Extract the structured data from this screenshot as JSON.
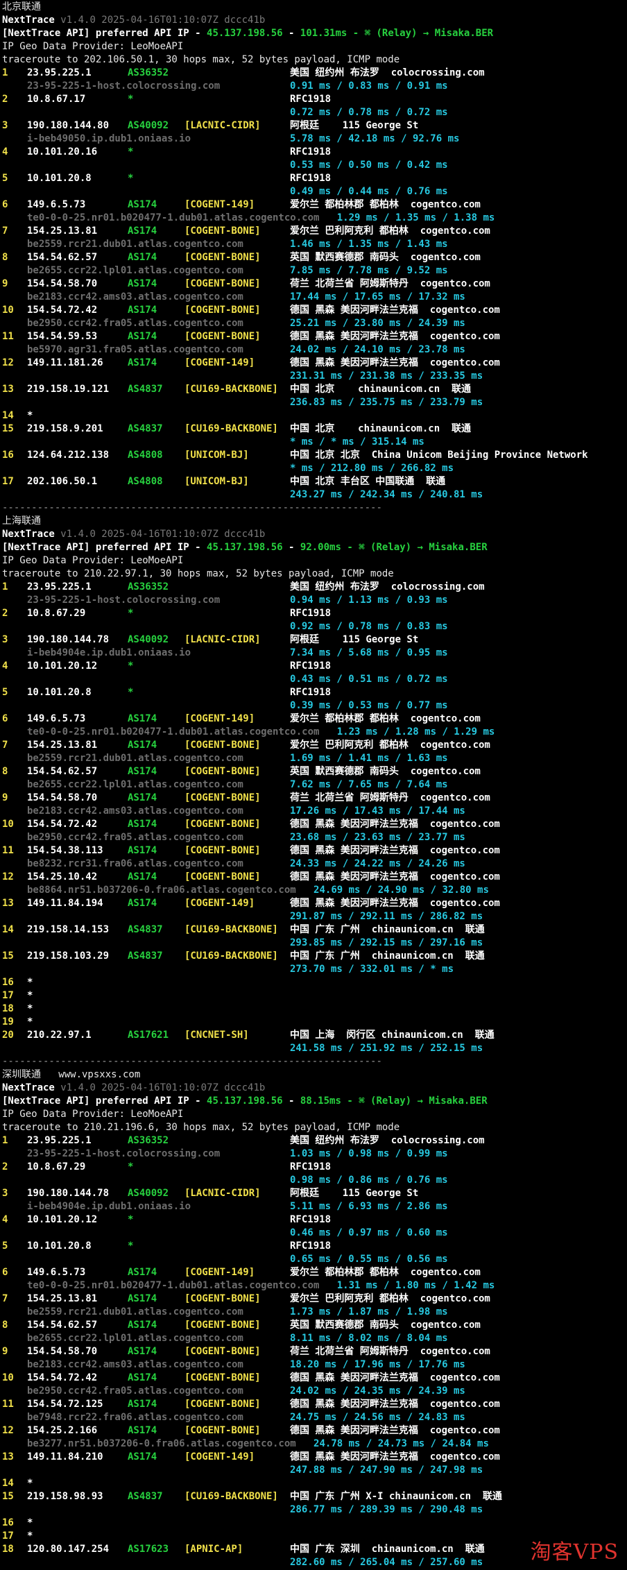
{
  "watermark": "淘客VPS",
  "sections": [
    {
      "title": "北京联通",
      "tool_name": "NextTrace",
      "tool_meta": "v1.4.0 2025-04-16T01:10:07Z dccc41b",
      "api_line": {
        "prefix": "[NextTrace API] preferred API IP - ",
        "ip": "45.137.198.56",
        "sep": " - ",
        "latency": "101.31ms",
        "relay": " - ⌘ (Relay) → Misaka.BER"
      },
      "geo_provider": "IP Geo Data Provider: LeoMoeAPI",
      "traceroute": "traceroute to 202.106.50.1, 30 hops max, 52 bytes payload, ICMP mode",
      "hops": [
        {
          "n": "1",
          "ip": "23.95.225.1",
          "asn": "AS36352",
          "tag": "",
          "geo": "美国 纽约州 布法罗  colocrossing.com",
          "host": "23-95-225-1-host.colocrossing.com",
          "rtt": "0.91 ms / 0.83 ms / 0.91 ms"
        },
        {
          "n": "2",
          "ip": "10.8.67.17",
          "asn": "*",
          "tag": "",
          "geo": "RFC1918",
          "host": "",
          "rtt": "0.72 ms / 0.78 ms / 0.72 ms"
        },
        {
          "n": "3",
          "ip": "190.180.144.80",
          "asn": "AS40092",
          "tag": "[LACNIC-CIDR]",
          "geo": "阿根廷    115 George St",
          "host": "i-beb49050.ip.dub1.oniaas.io",
          "rtt": "5.78 ms / 42.18 ms / 92.76 ms"
        },
        {
          "n": "4",
          "ip": "10.101.20.16",
          "asn": "*",
          "tag": "",
          "geo": "RFC1918",
          "host": "",
          "rtt": "0.53 ms / 0.50 ms / 0.42 ms"
        },
        {
          "n": "5",
          "ip": "10.101.20.8",
          "asn": "*",
          "tag": "",
          "geo": "RFC1918",
          "host": "",
          "rtt": "0.49 ms / 0.44 ms / 0.76 ms"
        },
        {
          "n": "6",
          "ip": "149.6.5.73",
          "asn": "AS174",
          "tag": "[COGENT-149]",
          "geo": "爱尔兰 都柏林郡 都柏林  cogentco.com",
          "host": "te0-0-0-25.nr01.b020477-1.dub01.atlas.cogentco.com",
          "rtt": "1.29 ms / 1.35 ms / 1.38 ms",
          "inline": true
        },
        {
          "n": "7",
          "ip": "154.25.13.81",
          "asn": "AS174",
          "tag": "[COGENT-BONE]",
          "geo": "爱尔兰 巴利阿克利 都柏林  cogentco.com",
          "host": "be2559.rcr21.dub01.atlas.cogentco.com",
          "rtt": "1.46 ms / 1.35 ms / 1.43 ms"
        },
        {
          "n": "8",
          "ip": "154.54.62.57",
          "asn": "AS174",
          "tag": "[COGENT-BONE]",
          "geo": "英国 默西赛德郡 南码头  cogentco.com",
          "host": "be2655.ccr22.lpl01.atlas.cogentco.com",
          "rtt": "7.85 ms / 7.78 ms / 9.52 ms"
        },
        {
          "n": "9",
          "ip": "154.54.58.70",
          "asn": "AS174",
          "tag": "[COGENT-BONE]",
          "geo": "荷兰 北荷兰省 阿姆斯特丹  cogentco.com",
          "host": "be2183.ccr42.ams03.atlas.cogentco.com",
          "rtt": "17.44 ms / 17.65 ms / 17.32 ms"
        },
        {
          "n": "10",
          "ip": "154.54.72.42",
          "asn": "AS174",
          "tag": "[COGENT-BONE]",
          "geo": "德国 黑森 美因河畔法兰克福  cogentco.com",
          "host": "be2950.ccr42.fra05.atlas.cogentco.com",
          "rtt": "25.21 ms / 23.80 ms / 24.39 ms"
        },
        {
          "n": "11",
          "ip": "154.54.59.53",
          "asn": "AS174",
          "tag": "[COGENT-BONE]",
          "geo": "德国 黑森 美因河畔法兰克福  cogentco.com",
          "host": "be5970.agr31.fra05.atlas.cogentco.com",
          "rtt": "24.02 ms / 24.10 ms / 23.78 ms"
        },
        {
          "n": "12",
          "ip": "149.11.181.26",
          "asn": "AS174",
          "tag": "[COGENT-149]",
          "geo": "德国 黑森 美因河畔法兰克福  cogentco.com",
          "host": "",
          "rtt": "231.31 ms / 231.38 ms / 233.35 ms"
        },
        {
          "n": "13",
          "ip": "219.158.19.121",
          "asn": "AS4837",
          "tag": "[CU169-BACKBONE]",
          "geo": "中国 北京    chinaunicom.cn  联通",
          "host": "",
          "rtt": "236.83 ms / 235.75 ms / 233.79 ms"
        },
        {
          "n": "14",
          "ip": "*",
          "asn": "",
          "tag": "",
          "geo": "",
          "host": "",
          "rtt": ""
        },
        {
          "n": "15",
          "ip": "219.158.9.201",
          "asn": "AS4837",
          "tag": "[CU169-BACKBONE]",
          "geo": "中国 北京    chinaunicom.cn  联通",
          "host": "",
          "rtt": "* ms / * ms / 315.14 ms"
        },
        {
          "n": "16",
          "ip": "124.64.212.138",
          "asn": "AS4808",
          "tag": "[UNICOM-BJ]",
          "geo": "中国 北京 北京  China Unicom Beijing Province Network",
          "host": "",
          "rtt": "* ms / 212.80 ms / 266.82 ms"
        },
        {
          "n": "17",
          "ip": "202.106.50.1",
          "asn": "AS4808",
          "tag": "[UNICOM-BJ]",
          "geo": "中国 北京 丰台区 中国联通  联通",
          "host": "",
          "rtt": "243.27 ms / 242.34 ms / 240.81 ms"
        }
      ]
    },
    {
      "title": "上海联通",
      "tool_name": "NextTrace",
      "tool_meta": "v1.4.0 2025-04-16T01:10:07Z dccc41b",
      "api_line": {
        "prefix": "[NextTrace API] preferred API IP - ",
        "ip": "45.137.198.56",
        "sep": " - ",
        "latency": "92.00ms",
        "relay": " - ⌘ (Relay) → Misaka.BER"
      },
      "geo_provider": "IP Geo Data Provider: LeoMoeAPI",
      "traceroute": "traceroute to 210.22.97.1, 30 hops max, 52 bytes payload, ICMP mode",
      "hops": [
        {
          "n": "1",
          "ip": "23.95.225.1",
          "asn": "AS36352",
          "tag": "",
          "geo": "美国 纽约州 布法罗  colocrossing.com",
          "host": "23-95-225-1-host.colocrossing.com",
          "rtt": "0.94 ms / 1.13 ms / 0.93 ms"
        },
        {
          "n": "2",
          "ip": "10.8.67.29",
          "asn": "*",
          "tag": "",
          "geo": "RFC1918",
          "host": "",
          "rtt": "0.92 ms / 0.78 ms / 0.83 ms"
        },
        {
          "n": "3",
          "ip": "190.180.144.78",
          "asn": "AS40092",
          "tag": "[LACNIC-CIDR]",
          "geo": "阿根廷    115 George St",
          "host": "i-beb4904e.ip.dub1.oniaas.io",
          "rtt": "7.34 ms / 5.68 ms / 0.95 ms"
        },
        {
          "n": "4",
          "ip": "10.101.20.12",
          "asn": "*",
          "tag": "",
          "geo": "RFC1918",
          "host": "",
          "rtt": "0.43 ms / 0.51 ms / 0.72 ms"
        },
        {
          "n": "5",
          "ip": "10.101.20.8",
          "asn": "*",
          "tag": "",
          "geo": "RFC1918",
          "host": "",
          "rtt": "0.39 ms / 0.53 ms / 0.77 ms"
        },
        {
          "n": "6",
          "ip": "149.6.5.73",
          "asn": "AS174",
          "tag": "[COGENT-149]",
          "geo": "爱尔兰 都柏林郡 都柏林  cogentco.com",
          "host": "te0-0-0-25.nr01.b020477-1.dub01.atlas.cogentco.com",
          "rtt": "1.23 ms / 1.28 ms / 1.29 ms",
          "inline": true
        },
        {
          "n": "7",
          "ip": "154.25.13.81",
          "asn": "AS174",
          "tag": "[COGENT-BONE]",
          "geo": "爱尔兰 巴利阿克利 都柏林  cogentco.com",
          "host": "be2559.rcr21.dub01.atlas.cogentco.com",
          "rtt": "1.69 ms / 1.41 ms / 1.63 ms"
        },
        {
          "n": "8",
          "ip": "154.54.62.57",
          "asn": "AS174",
          "tag": "[COGENT-BONE]",
          "geo": "英国 默西赛德郡 南码头  cogentco.com",
          "host": "be2655.ccr22.lpl01.atlas.cogentco.com",
          "rtt": "7.62 ms / 7.65 ms / 7.64 ms"
        },
        {
          "n": "9",
          "ip": "154.54.58.70",
          "asn": "AS174",
          "tag": "[COGENT-BONE]",
          "geo": "荷兰 北荷兰省 阿姆斯特丹  cogentco.com",
          "host": "be2183.ccr42.ams03.atlas.cogentco.com",
          "rtt": "17.26 ms / 17.43 ms / 17.44 ms"
        },
        {
          "n": "10",
          "ip": "154.54.72.42",
          "asn": "AS174",
          "tag": "[COGENT-BONE]",
          "geo": "德国 黑森 美因河畔法兰克福  cogentco.com",
          "host": "be2950.ccr42.fra05.atlas.cogentco.com",
          "rtt": "23.68 ms / 23.63 ms / 23.77 ms"
        },
        {
          "n": "11",
          "ip": "154.54.38.113",
          "asn": "AS174",
          "tag": "[COGENT-BONE]",
          "geo": "德国 黑森 美因河畔法兰克福  cogentco.com",
          "host": "be8232.rcr31.fra06.atlas.cogentco.com",
          "rtt": "24.33 ms / 24.22 ms / 24.26 ms"
        },
        {
          "n": "12",
          "ip": "154.25.10.42",
          "asn": "AS174",
          "tag": "[COGENT-BONE]",
          "geo": "德国 黑森 美因河畔法兰克福  cogentco.com",
          "host": "be8864.nr51.b037206-0.fra06.atlas.cogentco.com",
          "rtt": "24.69 ms / 24.90 ms / 32.80 ms",
          "inline": true
        },
        {
          "n": "13",
          "ip": "149.11.84.194",
          "asn": "AS174",
          "tag": "[COGENT-149]",
          "geo": "德国 黑森 美因河畔法兰克福  cogentco.com",
          "host": "",
          "rtt": "291.87 ms / 292.11 ms / 286.82 ms"
        },
        {
          "n": "14",
          "ip": "219.158.14.153",
          "asn": "AS4837",
          "tag": "[CU169-BACKBONE]",
          "geo": "中国 广东 广州  chinaunicom.cn  联通",
          "host": "",
          "rtt": "293.85 ms / 292.15 ms / 297.16 ms"
        },
        {
          "n": "15",
          "ip": "219.158.103.29",
          "asn": "AS4837",
          "tag": "[CU169-BACKBONE]",
          "geo": "中国 广东 广州  chinaunicom.cn  联通",
          "host": "",
          "rtt": "273.70 ms / 332.01 ms / * ms"
        },
        {
          "n": "16",
          "ip": "*",
          "asn": "",
          "tag": "",
          "geo": "",
          "host": "",
          "rtt": ""
        },
        {
          "n": "17",
          "ip": "*",
          "asn": "",
          "tag": "",
          "geo": "",
          "host": "",
          "rtt": ""
        },
        {
          "n": "18",
          "ip": "*",
          "asn": "",
          "tag": "",
          "geo": "",
          "host": "",
          "rtt": ""
        },
        {
          "n": "19",
          "ip": "*",
          "asn": "",
          "tag": "",
          "geo": "",
          "host": "",
          "rtt": ""
        },
        {
          "n": "20",
          "ip": "210.22.97.1",
          "asn": "AS17621",
          "tag": "[CNCNET-SH]",
          "geo": "中国 上海  闵行区 chinaunicom.cn  联通",
          "host": "",
          "rtt": "241.58 ms / 251.92 ms / 252.15 ms"
        }
      ]
    },
    {
      "title": "深圳联通   www.vpsxxs.com",
      "tool_name": "NextTrace",
      "tool_meta": "v1.4.0 2025-04-16T01:10:07Z dccc41b",
      "api_line": {
        "prefix": "[NextTrace API] preferred API IP - ",
        "ip": "45.137.198.56",
        "sep": " - ",
        "latency": "88.15ms",
        "relay": " - ⌘ (Relay) → Misaka.BER"
      },
      "geo_provider": "IP Geo Data Provider: LeoMoeAPI",
      "traceroute": "traceroute to 210.21.196.6, 30 hops max, 52 bytes payload, ICMP mode",
      "hops": [
        {
          "n": "1",
          "ip": "23.95.225.1",
          "asn": "AS36352",
          "tag": "",
          "geo": "美国 纽约州 布法罗  colocrossing.com",
          "host": "23-95-225-1-host.colocrossing.com",
          "rtt": "1.03 ms / 0.98 ms / 0.99 ms"
        },
        {
          "n": "2",
          "ip": "10.8.67.29",
          "asn": "*",
          "tag": "",
          "geo": "RFC1918",
          "host": "",
          "rtt": "0.98 ms / 0.86 ms / 0.76 ms"
        },
        {
          "n": "3",
          "ip": "190.180.144.78",
          "asn": "AS40092",
          "tag": "[LACNIC-CIDR]",
          "geo": "阿根廷    115 George St",
          "host": "i-beb4904e.ip.dub1.oniaas.io",
          "rtt": "5.11 ms / 6.93 ms / 2.86 ms"
        },
        {
          "n": "4",
          "ip": "10.101.20.12",
          "asn": "*",
          "tag": "",
          "geo": "RFC1918",
          "host": "",
          "rtt": "0.46 ms / 0.97 ms / 0.60 ms"
        },
        {
          "n": "5",
          "ip": "10.101.20.8",
          "asn": "*",
          "tag": "",
          "geo": "RFC1918",
          "host": "",
          "rtt": "0.65 ms / 0.55 ms / 0.56 ms"
        },
        {
          "n": "6",
          "ip": "149.6.5.73",
          "asn": "AS174",
          "tag": "[COGENT-149]",
          "geo": "爱尔兰 都柏林郡 都柏林  cogentco.com",
          "host": "te0-0-0-25.nr01.b020477-1.dub01.atlas.cogentco.com",
          "rtt": "1.31 ms / 1.80 ms / 1.42 ms",
          "inline": true
        },
        {
          "n": "7",
          "ip": "154.25.13.81",
          "asn": "AS174",
          "tag": "[COGENT-BONE]",
          "geo": "爱尔兰 巴利阿克利 都柏林  cogentco.com",
          "host": "be2559.rcr21.dub01.atlas.cogentco.com",
          "rtt": "1.73 ms / 1.87 ms / 1.98 ms"
        },
        {
          "n": "8",
          "ip": "154.54.62.57",
          "asn": "AS174",
          "tag": "[COGENT-BONE]",
          "geo": "英国 默西赛德郡 南码头  cogentco.com",
          "host": "be2655.ccr22.lpl01.atlas.cogentco.com",
          "rtt": "8.11 ms / 8.02 ms / 8.04 ms"
        },
        {
          "n": "9",
          "ip": "154.54.58.70",
          "asn": "AS174",
          "tag": "[COGENT-BONE]",
          "geo": "荷兰 北荷兰省 阿姆斯特丹  cogentco.com",
          "host": "be2183.ccr42.ams03.atlas.cogentco.com",
          "rtt": "18.20 ms / 17.96 ms / 17.76 ms"
        },
        {
          "n": "10",
          "ip": "154.54.72.42",
          "asn": "AS174",
          "tag": "[COGENT-BONE]",
          "geo": "德国 黑森 美因河畔法兰克福  cogentco.com",
          "host": "be2950.ccr42.fra05.atlas.cogentco.com",
          "rtt": "24.02 ms / 24.35 ms / 24.39 ms"
        },
        {
          "n": "11",
          "ip": "154.54.72.125",
          "asn": "AS174",
          "tag": "[COGENT-BONE]",
          "geo": "德国 黑森 美因河畔法兰克福  cogentco.com",
          "host": "be7948.rcr22.fra06.atlas.cogentco.com",
          "rtt": "24.75 ms / 24.56 ms / 24.83 ms"
        },
        {
          "n": "12",
          "ip": "154.25.2.166",
          "asn": "AS174",
          "tag": "[COGENT-BONE]",
          "geo": "德国 黑森 美因河畔法兰克福  cogentco.com",
          "host": "be3277.nr51.b037206-0.fra06.atlas.cogentco.com",
          "rtt": "24.78 ms / 24.73 ms / 24.84 ms",
          "inline": true
        },
        {
          "n": "13",
          "ip": "149.11.84.210",
          "asn": "AS174",
          "tag": "[COGENT-149]",
          "geo": "德国 黑森 美因河畔法兰克福  cogentco.com",
          "host": "",
          "rtt": "247.88 ms / 247.90 ms / 247.98 ms"
        },
        {
          "n": "14",
          "ip": "*",
          "asn": "",
          "tag": "",
          "geo": "",
          "host": "",
          "rtt": ""
        },
        {
          "n": "15",
          "ip": "219.158.98.93",
          "asn": "AS4837",
          "tag": "[CU169-BACKBONE]",
          "geo": "中国 广东 广州 X-I chinaunicom.cn  联通",
          "host": "",
          "rtt": "286.77 ms / 289.39 ms / 290.48 ms"
        },
        {
          "n": "16",
          "ip": "*",
          "asn": "",
          "tag": "",
          "geo": "",
          "host": "",
          "rtt": ""
        },
        {
          "n": "17",
          "ip": "*",
          "asn": "",
          "tag": "",
          "geo": "",
          "host": "",
          "rtt": ""
        },
        {
          "n": "18",
          "ip": "120.80.147.254",
          "asn": "AS17623",
          "tag": "[APNIC-AP]",
          "geo": "中国 广东 深圳  chinaunicom.cn  联通",
          "host": "",
          "rtt": "282.60 ms / 265.04 ms / 257.60 ms"
        }
      ]
    }
  ],
  "separator": "-----------------------------------------------------------------"
}
